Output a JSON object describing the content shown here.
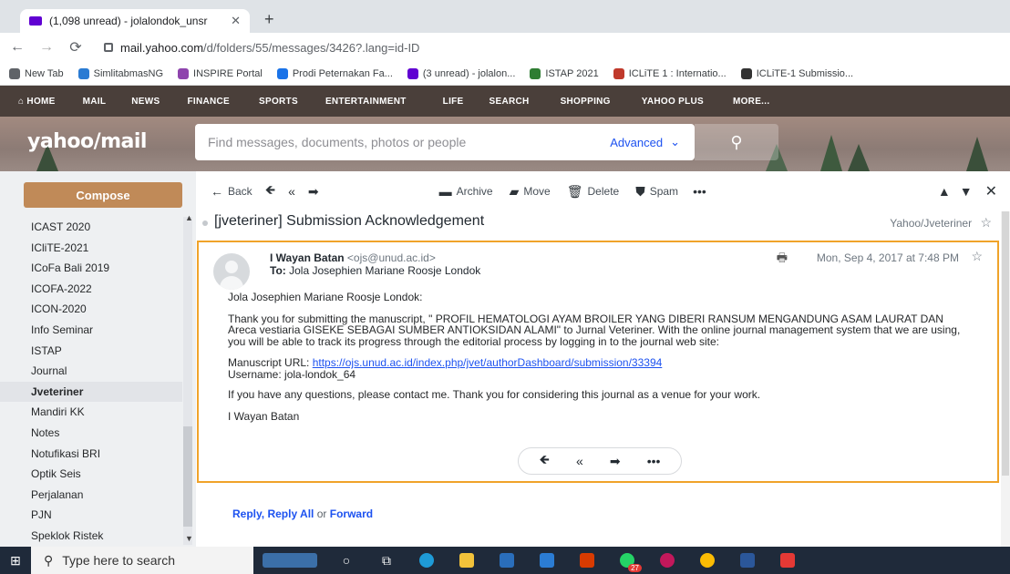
{
  "browser": {
    "tab_title": "(1,098 unread) - jolalondok_unsr",
    "url_domain": "mail.yahoo.com",
    "url_path": "/d/folders/55/messages/3426?.lang=id-ID",
    "bookmarks": [
      {
        "label": "New Tab",
        "color": "#5f6368"
      },
      {
        "label": "SimlitabmasNG",
        "color": "#2a7bd3"
      },
      {
        "label": "INSPIRE Portal",
        "color": "#8e44ad"
      },
      {
        "label": "Prodi Peternakan Fa...",
        "color": "#1a73e8"
      },
      {
        "label": "(3 unread) - jolalon...",
        "color": "#6001d2"
      },
      {
        "label": "ISTAP 2021",
        "color": "#2e7d32"
      },
      {
        "label": "ICLiTE 1 : Internatio...",
        "color": "#c0392b"
      },
      {
        "label": "ICLiTE-1 Submissio...",
        "color": "#333333"
      }
    ]
  },
  "yahoo_nav": [
    "HOME",
    "MAIL",
    "NEWS",
    "FINANCE",
    "SPORTS",
    "ENTERTAINMENT",
    "LIFE",
    "SEARCH",
    "SHOPPING",
    "YAHOO PLUS",
    "MORE..."
  ],
  "header": {
    "logo": "yahoo/mail",
    "search_placeholder": "Find messages, documents, photos or people",
    "advanced": "Advanced"
  },
  "sidebar": {
    "compose": "Compose",
    "folders": [
      "ICAST 2020",
      "ICliTE-2021",
      "ICoFa Bali 2019",
      "ICOFA-2022",
      "ICON-2020",
      "Info Seminar",
      "ISTAP",
      "Journal",
      "Jveteriner",
      "Mandiri KK",
      "Notes",
      "Notufikasi BRI",
      "Optik Seis",
      "Perjalanan",
      "PJN",
      "Speklok Ristek"
    ],
    "active_folder": "Jveteriner"
  },
  "toolbar": {
    "back": "Back",
    "archive": "Archive",
    "move": "Move",
    "delete": "Delete",
    "spam": "Spam"
  },
  "message": {
    "subject": "[jveteriner] Submission Acknowledgement",
    "folder_path": "Yahoo/Jveteriner",
    "from_name": "I Wayan Batan",
    "from_email": "<ojs@unud.ac.id>",
    "to_label": "To:",
    "to_name": "Jola Josephien Mariane Roosje Londok",
    "date": "Mon, Sep 4, 2017 at 7:48 PM",
    "greeting": "Jola Josephien Mariane Roosje Londok:",
    "paragraph1": "Thank you for submitting the manuscript, \" PROFIL HEMATOLOGI AYAM BROILER YANG DIBERI RANSUM MENGANDUNG ASAM LAURAT DAN Areca vestiaria GISEKE SEBAGAI SUMBER ANTIOKSIDAN ALAMI\" to Jurnal Veteriner. With the online journal management system that we are using, you will be able to track its progress through the editorial process by logging in to the journal web site:",
    "manuscript_label": "Manuscript URL:",
    "manuscript_url": "https://ojs.unud.ac.id/index.php/jvet/authorDashboard/submission/33394",
    "username": "Username: jola-londok_64",
    "paragraph2": "If you have any questions, please contact me. Thank you for considering this journal as a venue for your work.",
    "signature": "I Wayan Batan"
  },
  "reply_links": {
    "reply": "Reply",
    "reply_all": "Reply All",
    "or": "or",
    "forward": "Forward"
  },
  "taskbar": {
    "search_placeholder": "Type here to search",
    "badge": "27"
  },
  "colors": {
    "accent_orange": "#f0a32a",
    "compose": "#c08a58",
    "link": "#1d52f0",
    "nav_bg": "#4a3f3a"
  }
}
